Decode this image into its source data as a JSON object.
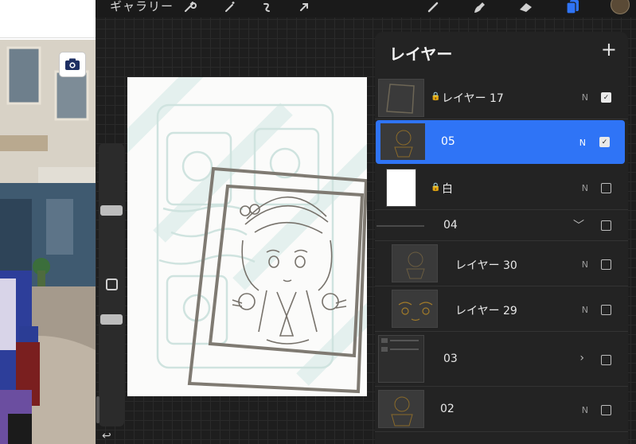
{
  "toolbar": {
    "gallery_label": "ギャラリー",
    "icons": [
      "wrench-icon",
      "magic-wand-icon",
      "selection-icon",
      "transform-arrow-icon",
      "brush-icon",
      "smudge-icon",
      "eraser-icon",
      "layers-icon"
    ]
  },
  "layers_panel": {
    "title": "レイヤー",
    "add_label": "+",
    "layers": [
      {
        "name": "レイヤー 17",
        "blend": "N",
        "locked": true,
        "visible": true,
        "selected": false
      },
      {
        "name": "05",
        "blend": "N",
        "locked": false,
        "visible": true,
        "selected": true
      },
      {
        "name": "白",
        "blend": "N",
        "locked": true,
        "visible": false,
        "selected": false
      },
      {
        "name": "04",
        "group": true,
        "expanded": true,
        "visible": false
      },
      {
        "name": "レイヤー 30",
        "blend": "N",
        "visible": false,
        "indent": true
      },
      {
        "name": "レイヤー 29",
        "blend": "N",
        "visible": false,
        "indent": true
      },
      {
        "name": "03",
        "group": true,
        "expanded": false,
        "visible": false
      },
      {
        "name": "02",
        "blend": "N",
        "visible": false
      }
    ]
  },
  "colors": {
    "accent": "#2f74f6",
    "panel_bg": "#232323",
    "app_bg": "#1e1e1e"
  }
}
